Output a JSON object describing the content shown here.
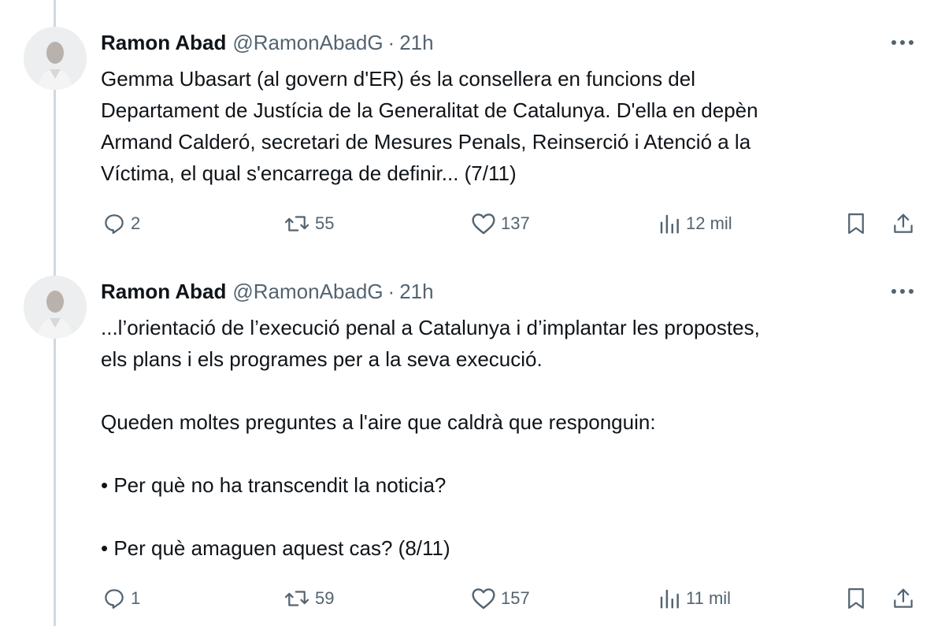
{
  "tweets": [
    {
      "author": {
        "name": "Ramon Abad",
        "handle": "@RamonAbadG",
        "separator": "·",
        "time": "21h"
      },
      "paragraphs": [
        "Gemma Ubasart (al govern d'ER) és la consellera en funcions del",
        "Departament de Justícia de la Generalitat de Catalunya. D'ella en depèn",
        "Armand Calderó, secretari de Mesures Penals, Reinserció i Atenció a la",
        "Víctima, el qual s'encarrega de definir... (7/11)"
      ],
      "stats": {
        "replies": "2",
        "retweets": "55",
        "likes": "137",
        "views": "12 mil"
      }
    },
    {
      "author": {
        "name": "Ramon Abad",
        "handle": "@RamonAbadG",
        "separator": "·",
        "time": "21h"
      },
      "paragraphs": [
        "...l’orientació de l’execució penal a Catalunya i d’implantar les propostes,",
        "els plans i els programes per a la seva execució.",
        "",
        "Queden moltes preguntes a l'aire que caldrà que responguin:",
        "",
        "• Per què no ha transcendit la noticia?",
        "",
        "• Per què amaguen aquest cas? (8/11)"
      ],
      "stats": {
        "replies": "1",
        "retweets": "59",
        "likes": "157",
        "views": "11 mil"
      }
    }
  ],
  "icons": {
    "reply": "reply-icon",
    "retweet": "retweet-icon",
    "like": "heart-icon",
    "views": "views-icon",
    "bookmark": "bookmark-icon",
    "share": "share-icon",
    "more": "more-icon"
  },
  "colors": {
    "text": "#0f1419",
    "secondary": "#536471",
    "thread_line": "#cfd9de"
  }
}
